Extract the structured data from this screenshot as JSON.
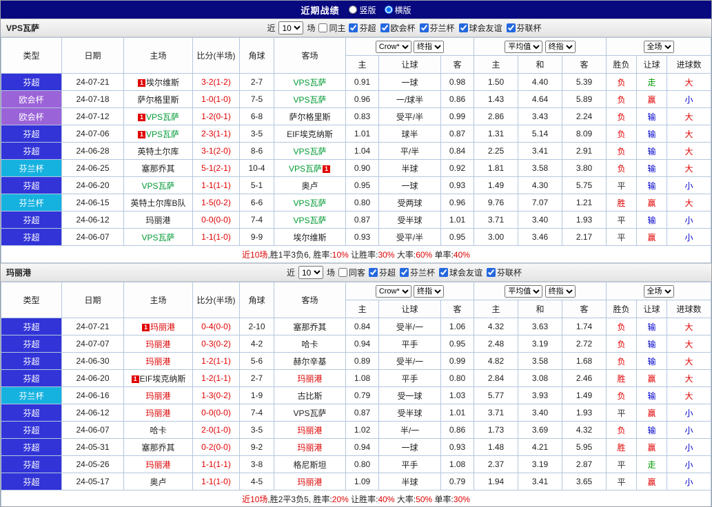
{
  "titlebar": {
    "title": "近期战绩",
    "view_options": [
      {
        "label": "竖版",
        "selected": false
      },
      {
        "label": "横版",
        "selected": true
      }
    ]
  },
  "table_header": {
    "static_cols": [
      "类型",
      "日期",
      "主场",
      "比分(半场)",
      "角球",
      "客场"
    ],
    "odds_group": {
      "select1": "Crow*",
      "select2": "终指",
      "sub": [
        "主",
        "让球",
        "客"
      ]
    },
    "avg_group": {
      "select1": "平均值",
      "select2": "终指",
      "sub": [
        "主",
        "和",
        "客"
      ]
    },
    "full_group": {
      "select1": "全场",
      "sub": [
        "胜负",
        "让球",
        "进球数"
      ]
    }
  },
  "colors": {
    "league": {
      "blue": "#3234d8",
      "purple": "#9b63d8",
      "cyan": "#15b2e0"
    },
    "focus": {
      "green": "#009933",
      "red": "#dd0000"
    },
    "result": {
      "red": "#e10000",
      "blue": "#0000cc",
      "green": "#009900",
      "black": "#333333"
    },
    "summary": {
      "red": "#dd0000",
      "black": "#222222"
    },
    "score": "#e10000",
    "badge": "#e10000",
    "titlebar_bg": "#08087f"
  },
  "sections": [
    {
      "team": "VPS瓦萨",
      "focus": "green",
      "filter": {
        "prefix": "近",
        "count": "10",
        "suffix": "场",
        "venue": {
          "label": "同主",
          "checked": false
        },
        "competitions": [
          {
            "label": "芬超",
            "checked": true
          },
          {
            "label": "欧会杯",
            "checked": true
          },
          {
            "label": "芬兰杯",
            "checked": true
          },
          {
            "label": "球会友谊",
            "checked": true
          },
          {
            "label": "芬联杯",
            "checked": true
          }
        ]
      },
      "rows": [
        {
          "league": "芬超",
          "lc": "blue",
          "date": "24-07-21",
          "home": {
            "name": "埃尔维斯",
            "badge_pre": "1"
          },
          "score": "3-2(1-2)",
          "corner": "2-7",
          "away": {
            "name": "VPS瓦萨",
            "focus": true
          },
          "odds": [
            "0.91",
            "一球",
            "0.98"
          ],
          "avg": [
            "1.50",
            "4.40",
            "5.39"
          ],
          "res": [
            {
              "t": "负",
              "c": "red"
            },
            {
              "t": "走",
              "c": "green"
            },
            {
              "t": "大",
              "c": "red"
            }
          ]
        },
        {
          "league": "欧会杯",
          "lc": "purple",
          "date": "24-07-18",
          "home": {
            "name": "萨尔格里斯"
          },
          "score": "1-0(1-0)",
          "corner": "7-5",
          "away": {
            "name": "VPS瓦萨",
            "focus": true
          },
          "odds": [
            "0.96",
            "一/球半",
            "0.86"
          ],
          "avg": [
            "1.43",
            "4.64",
            "5.89"
          ],
          "res": [
            {
              "t": "负",
              "c": "red"
            },
            {
              "t": "赢",
              "c": "red"
            },
            {
              "t": "小",
              "c": "blue"
            }
          ]
        },
        {
          "league": "欧会杯",
          "lc": "purple",
          "date": "24-07-12",
          "home": {
            "name": "VPS瓦萨",
            "focus": true,
            "badge_pre": "1"
          },
          "score": "1-2(0-1)",
          "corner": "6-8",
          "away": {
            "name": "萨尔格里斯"
          },
          "odds": [
            "0.83",
            "受平/半",
            "0.99"
          ],
          "avg": [
            "2.86",
            "3.43",
            "2.24"
          ],
          "res": [
            {
              "t": "负",
              "c": "red"
            },
            {
              "t": "输",
              "c": "blue"
            },
            {
              "t": "大",
              "c": "red"
            }
          ]
        },
        {
          "league": "芬超",
          "lc": "blue",
          "date": "24-07-06",
          "home": {
            "name": "VPS瓦萨",
            "focus": true,
            "badge_pre": "1"
          },
          "score": "2-3(1-1)",
          "corner": "3-5",
          "away": {
            "name": "EIF埃克纳斯"
          },
          "odds": [
            "1.01",
            "球半",
            "0.87"
          ],
          "avg": [
            "1.31",
            "5.14",
            "8.09"
          ],
          "res": [
            {
              "t": "负",
              "c": "red"
            },
            {
              "t": "输",
              "c": "blue"
            },
            {
              "t": "大",
              "c": "red"
            }
          ]
        },
        {
          "league": "芬超",
          "lc": "blue",
          "date": "24-06-28",
          "home": {
            "name": "英特土尔库"
          },
          "score": "3-1(2-0)",
          "corner": "8-6",
          "away": {
            "name": "VPS瓦萨",
            "focus": true
          },
          "odds": [
            "1.04",
            "平/半",
            "0.84"
          ],
          "avg": [
            "2.25",
            "3.41",
            "2.91"
          ],
          "res": [
            {
              "t": "负",
              "c": "red"
            },
            {
              "t": "输",
              "c": "blue"
            },
            {
              "t": "大",
              "c": "red"
            }
          ]
        },
        {
          "league": "芬兰杯",
          "lc": "cyan",
          "date": "24-06-25",
          "home": {
            "name": "塞那乔其"
          },
          "score": "5-1(2-1)",
          "corner": "10-4",
          "away": {
            "name": "VPS瓦萨",
            "focus": true,
            "badge_post": "1"
          },
          "odds": [
            "0.90",
            "半球",
            "0.92"
          ],
          "avg": [
            "1.81",
            "3.58",
            "3.80"
          ],
          "res": [
            {
              "t": "负",
              "c": "red"
            },
            {
              "t": "输",
              "c": "blue"
            },
            {
              "t": "大",
              "c": "red"
            }
          ]
        },
        {
          "league": "芬超",
          "lc": "blue",
          "date": "24-06-20",
          "home": {
            "name": "VPS瓦萨",
            "focus": true
          },
          "score": "1-1(1-1)",
          "corner": "5-1",
          "away": {
            "name": "奥卢"
          },
          "odds": [
            "0.95",
            "一球",
            "0.93"
          ],
          "avg": [
            "1.49",
            "4.30",
            "5.75"
          ],
          "res": [
            {
              "t": "平",
              "c": "black"
            },
            {
              "t": "输",
              "c": "blue"
            },
            {
              "t": "小",
              "c": "blue"
            }
          ]
        },
        {
          "league": "芬兰杯",
          "lc": "cyan",
          "date": "24-06-15",
          "home": {
            "name": "英特土尔库B队"
          },
          "score": "1-5(0-2)",
          "corner": "6-6",
          "away": {
            "name": "VPS瓦萨",
            "focus": true
          },
          "odds": [
            "0.80",
            "受两球",
            "0.96"
          ],
          "avg": [
            "9.76",
            "7.07",
            "1.21"
          ],
          "res": [
            {
              "t": "胜",
              "c": "red"
            },
            {
              "t": "赢",
              "c": "red"
            },
            {
              "t": "大",
              "c": "red"
            }
          ]
        },
        {
          "league": "芬超",
          "lc": "blue",
          "date": "24-06-12",
          "home": {
            "name": "玛丽港"
          },
          "score": "0-0(0-0)",
          "corner": "7-4",
          "away": {
            "name": "VPS瓦萨",
            "focus": true
          },
          "odds": [
            "0.87",
            "受半球",
            "1.01"
          ],
          "avg": [
            "3.71",
            "3.40",
            "1.93"
          ],
          "res": [
            {
              "t": "平",
              "c": "black"
            },
            {
              "t": "输",
              "c": "blue"
            },
            {
              "t": "小",
              "c": "blue"
            }
          ]
        },
        {
          "league": "芬超",
          "lc": "blue",
          "date": "24-06-07",
          "home": {
            "name": "VPS瓦萨",
            "focus": true
          },
          "score": "1-1(1-0)",
          "corner": "9-9",
          "away": {
            "name": "埃尔维斯"
          },
          "odds": [
            "0.93",
            "受平/半",
            "0.95"
          ],
          "avg": [
            "3.00",
            "3.46",
            "2.17"
          ],
          "res": [
            {
              "t": "平",
              "c": "black"
            },
            {
              "t": "赢",
              "c": "red"
            },
            {
              "t": "小",
              "c": "blue"
            }
          ]
        }
      ],
      "summary": [
        {
          "text": "近10场",
          "color": "red"
        },
        {
          "text": ",胜1平3负6, 胜率:",
          "color": "black"
        },
        {
          "text": "10%",
          "color": "red"
        },
        {
          "text": " 让胜率:",
          "color": "black"
        },
        {
          "text": "30%",
          "color": "red"
        },
        {
          "text": " 大率:",
          "color": "black"
        },
        {
          "text": "60%",
          "color": "red"
        },
        {
          "text": " 单率:",
          "color": "black"
        },
        {
          "text": "40%",
          "color": "red"
        }
      ]
    },
    {
      "team": "玛丽港",
      "focus": "red",
      "filter": {
        "prefix": "近",
        "count": "10",
        "suffix": "场",
        "venue": {
          "label": "同客",
          "checked": false
        },
        "competitions": [
          {
            "label": "芬超",
            "checked": true
          },
          {
            "label": "芬兰杯",
            "checked": true
          },
          {
            "label": "球会友谊",
            "checked": true
          },
          {
            "label": "芬联杯",
            "checked": true
          }
        ]
      },
      "rows": [
        {
          "league": "芬超",
          "lc": "blue",
          "date": "24-07-21",
          "home": {
            "name": "玛丽港",
            "focus": true,
            "badge_pre": "1"
          },
          "score": "0-4(0-0)",
          "corner": "2-10",
          "away": {
            "name": "塞那乔其"
          },
          "odds": [
            "0.84",
            "受半/一",
            "1.06"
          ],
          "avg": [
            "4.32",
            "3.63",
            "1.74"
          ],
          "res": [
            {
              "t": "负",
              "c": "red"
            },
            {
              "t": "输",
              "c": "blue"
            },
            {
              "t": "大",
              "c": "red"
            }
          ]
        },
        {
          "league": "芬超",
          "lc": "blue",
          "date": "24-07-07",
          "home": {
            "name": "玛丽港",
            "focus": true
          },
          "score": "0-3(0-2)",
          "corner": "4-2",
          "away": {
            "name": "哈卡"
          },
          "odds": [
            "0.94",
            "平手",
            "0.95"
          ],
          "avg": [
            "2.48",
            "3.19",
            "2.72"
          ],
          "res": [
            {
              "t": "负",
              "c": "red"
            },
            {
              "t": "输",
              "c": "blue"
            },
            {
              "t": "大",
              "c": "red"
            }
          ]
        },
        {
          "league": "芬超",
          "lc": "blue",
          "date": "24-06-30",
          "home": {
            "name": "玛丽港",
            "focus": true
          },
          "score": "1-2(1-1)",
          "corner": "5-6",
          "away": {
            "name": "赫尔辛基"
          },
          "odds": [
            "0.89",
            "受半/一",
            "0.99"
          ],
          "avg": [
            "4.82",
            "3.58",
            "1.68"
          ],
          "res": [
            {
              "t": "负",
              "c": "red"
            },
            {
              "t": "输",
              "c": "blue"
            },
            {
              "t": "大",
              "c": "red"
            }
          ]
        },
        {
          "league": "芬超",
          "lc": "blue",
          "date": "24-06-20",
          "home": {
            "name": "EIF埃克纳斯",
            "badge_pre": "1"
          },
          "score": "1-2(1-1)",
          "corner": "2-7",
          "away": {
            "name": "玛丽港",
            "focus": true
          },
          "odds": [
            "1.08",
            "平手",
            "0.80"
          ],
          "avg": [
            "2.84",
            "3.08",
            "2.46"
          ],
          "res": [
            {
              "t": "胜",
              "c": "red"
            },
            {
              "t": "赢",
              "c": "red"
            },
            {
              "t": "大",
              "c": "red"
            }
          ]
        },
        {
          "league": "芬兰杯",
          "lc": "cyan",
          "date": "24-06-16",
          "home": {
            "name": "玛丽港",
            "focus": true
          },
          "score": "1-3(0-2)",
          "corner": "1-9",
          "away": {
            "name": "古比斯"
          },
          "odds": [
            "0.79",
            "受一球",
            "1.03"
          ],
          "avg": [
            "5.77",
            "3.93",
            "1.49"
          ],
          "res": [
            {
              "t": "负",
              "c": "red"
            },
            {
              "t": "输",
              "c": "blue"
            },
            {
              "t": "大",
              "c": "red"
            }
          ]
        },
        {
          "league": "芬超",
          "lc": "blue",
          "date": "24-06-12",
          "home": {
            "name": "玛丽港",
            "focus": true
          },
          "score": "0-0(0-0)",
          "corner": "7-4",
          "away": {
            "name": "VPS瓦萨"
          },
          "odds": [
            "0.87",
            "受半球",
            "1.01"
          ],
          "avg": [
            "3.71",
            "3.40",
            "1.93"
          ],
          "res": [
            {
              "t": "平",
              "c": "black"
            },
            {
              "t": "赢",
              "c": "red"
            },
            {
              "t": "小",
              "c": "blue"
            }
          ]
        },
        {
          "league": "芬超",
          "lc": "blue",
          "date": "24-06-07",
          "home": {
            "name": "哈卡"
          },
          "score": "2-0(1-0)",
          "corner": "3-5",
          "away": {
            "name": "玛丽港",
            "focus": true
          },
          "odds": [
            "1.02",
            "半/一",
            "0.86"
          ],
          "avg": [
            "1.73",
            "3.69",
            "4.32"
          ],
          "res": [
            {
              "t": "负",
              "c": "red"
            },
            {
              "t": "输",
              "c": "blue"
            },
            {
              "t": "小",
              "c": "blue"
            }
          ]
        },
        {
          "league": "芬超",
          "lc": "blue",
          "date": "24-05-31",
          "home": {
            "name": "塞那乔其"
          },
          "score": "0-2(0-0)",
          "corner": "9-2",
          "away": {
            "name": "玛丽港",
            "focus": true
          },
          "odds": [
            "0.94",
            "一球",
            "0.93"
          ],
          "avg": [
            "1.48",
            "4.21",
            "5.95"
          ],
          "res": [
            {
              "t": "胜",
              "c": "red"
            },
            {
              "t": "赢",
              "c": "red"
            },
            {
              "t": "小",
              "c": "blue"
            }
          ]
        },
        {
          "league": "芬超",
          "lc": "blue",
          "date": "24-05-26",
          "home": {
            "name": "玛丽港",
            "focus": true
          },
          "score": "1-1(1-1)",
          "corner": "3-8",
          "away": {
            "name": "格尼斯坦"
          },
          "odds": [
            "0.80",
            "平手",
            "1.08"
          ],
          "avg": [
            "2.37",
            "3.19",
            "2.87"
          ],
          "res": [
            {
              "t": "平",
              "c": "black"
            },
            {
              "t": "走",
              "c": "green"
            },
            {
              "t": "小",
              "c": "blue"
            }
          ]
        },
        {
          "league": "芬超",
          "lc": "blue",
          "date": "24-05-17",
          "home": {
            "name": "奥卢"
          },
          "score": "1-1(1-0)",
          "corner": "4-5",
          "away": {
            "name": "玛丽港",
            "focus": true
          },
          "odds": [
            "1.09",
            "半球",
            "0.79"
          ],
          "avg": [
            "1.94",
            "3.41",
            "3.65"
          ],
          "res": [
            {
              "t": "平",
              "c": "black"
            },
            {
              "t": "赢",
              "c": "red"
            },
            {
              "t": "小",
              "c": "blue"
            }
          ]
        }
      ],
      "summary": [
        {
          "text": "近10场",
          "color": "red"
        },
        {
          "text": ",胜2平3负5, 胜率:",
          "color": "black"
        },
        {
          "text": "20%",
          "color": "red"
        },
        {
          "text": " 让胜率:",
          "color": "black"
        },
        {
          "text": "40%",
          "color": "red"
        },
        {
          "text": " 大率:",
          "color": "black"
        },
        {
          "text": "50%",
          "color": "red"
        },
        {
          "text": " 单率:",
          "color": "black"
        },
        {
          "text": "30%",
          "color": "red"
        }
      ]
    }
  ]
}
